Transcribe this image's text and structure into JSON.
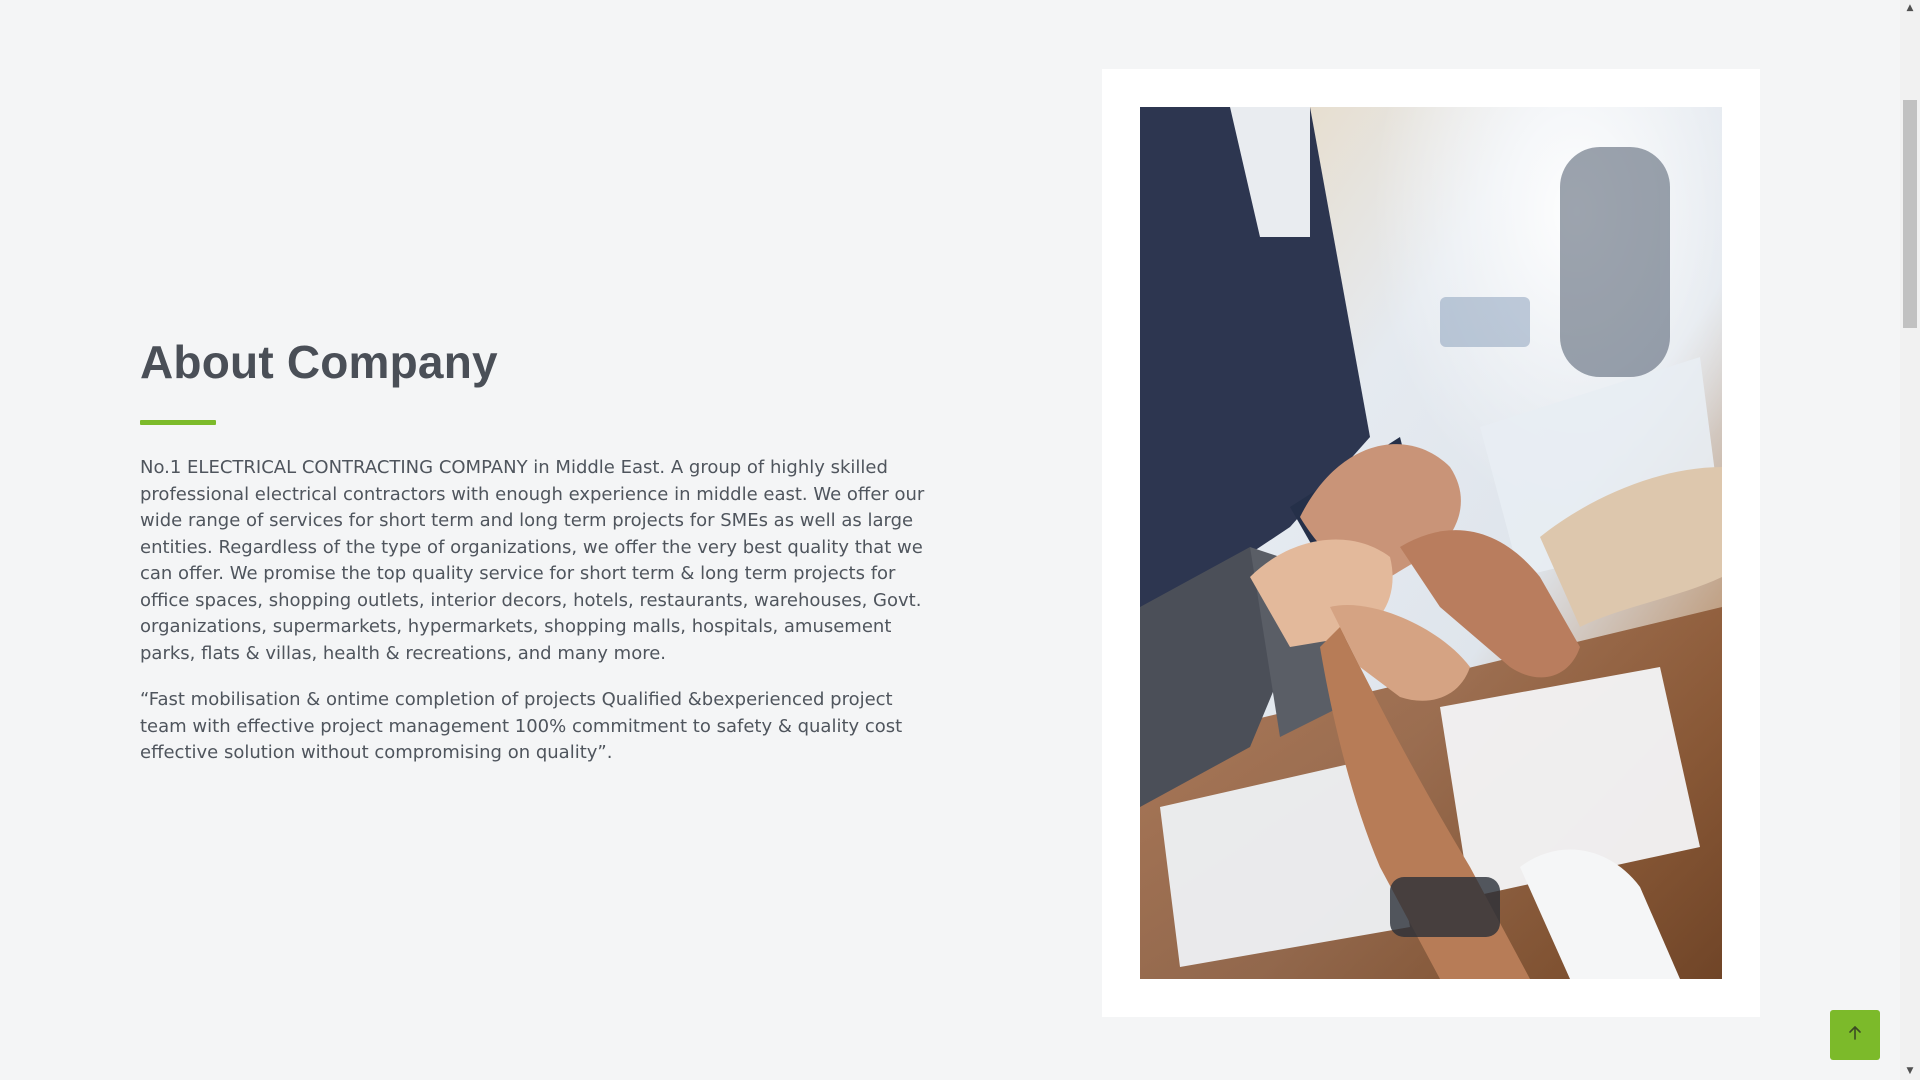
{
  "about": {
    "title": "About Company",
    "paragraph": "No.1 ELECTRICAL CONTRACTING COMPANY in Middle East. A group of highly skilled professional electrical contractors with enough experience in middle east. We offer our wide range of services for short term and long term projects for SMEs as well as large entities. Regardless of the type of organizations, we offer the very best quality that we can offer. We promise the top quality service for short term & long term projects for office spaces, shopping outlets, interior decors, hotels, restaurants, warehouses, Govt. organizations, supermarkets, hypermarkets, shopping malls, hospitals, amusement parks, flats & villas, health & recreations, and many more.",
    "quote": "“Fast mobilisation & ontime completion of projects Qualified &bexperienced project team with effective project management 100% commitment to safety & quality cost effective solution without compromising on quality”."
  },
  "image": {
    "subject": "team-hands-stacked-photo"
  },
  "colors": {
    "accent": "#7cba2a",
    "heading": "#4a4f57",
    "body_text": "#4f555d",
    "page_background": "#f4f5f6",
    "card_background": "#ffffff"
  },
  "controls": {
    "back_to_top_icon": "arrow-up-icon"
  }
}
